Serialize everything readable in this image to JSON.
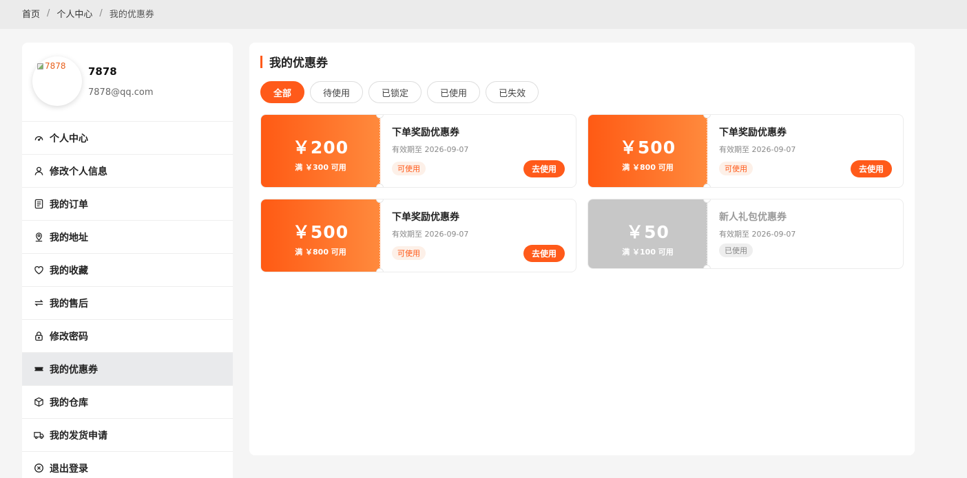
{
  "breadcrumb": {
    "home": "首页",
    "sep1": "/",
    "center": "个人中心",
    "sep2": "/",
    "current": "我的优惠券"
  },
  "profile": {
    "avatar_alt": "7878",
    "username": "7878",
    "email": "7878@qq.com"
  },
  "menu": [
    {
      "label": "个人中心",
      "icon": "dashboard-icon"
    },
    {
      "label": "修改个人信息",
      "icon": "user-icon"
    },
    {
      "label": "我的订单",
      "icon": "document-icon"
    },
    {
      "label": "我的地址",
      "icon": "location-icon"
    },
    {
      "label": "我的收藏",
      "icon": "heart-icon"
    },
    {
      "label": "我的售后",
      "icon": "swap-icon"
    },
    {
      "label": "修改密码",
      "icon": "lock-icon"
    },
    {
      "label": "我的优惠券",
      "icon": "ticket-icon",
      "active": true
    },
    {
      "label": "我的仓库",
      "icon": "box-icon"
    },
    {
      "label": "我的发货申请",
      "icon": "truck-icon"
    },
    {
      "label": "退出登录",
      "icon": "close-circle-icon"
    }
  ],
  "main": {
    "title": "我的优惠券",
    "tabs": [
      {
        "label": "全部",
        "active": true
      },
      {
        "label": "待使用"
      },
      {
        "label": "已锁定"
      },
      {
        "label": "已使用"
      },
      {
        "label": "已失效"
      }
    ]
  },
  "coupons": [
    {
      "amount": "￥200",
      "min_spend": "满 ￥300 可用",
      "name": "下单奖励优惠券",
      "expiry": "有效期至 2026-09-07",
      "status": "可使用",
      "action": "去使用"
    },
    {
      "amount": "￥500",
      "min_spend": "满 ￥800 可用",
      "name": "下单奖励优惠券",
      "expiry": "有效期至 2026-09-07",
      "status": "可使用",
      "action": "去使用"
    },
    {
      "amount": "￥500",
      "min_spend": "满 ￥800 可用",
      "name": "下单奖励优惠券",
      "expiry": "有效期至 2026-09-07",
      "status": "可使用",
      "action": "去使用"
    },
    {
      "amount": "￥50",
      "min_spend": "满 ￥100 可用",
      "name": "新人礼包优惠券",
      "expiry": "有效期至 2026-09-07",
      "status": "已使用"
    }
  ],
  "colors": {
    "accent": "#ff5a1a",
    "disabled": "#c7c7c7"
  }
}
